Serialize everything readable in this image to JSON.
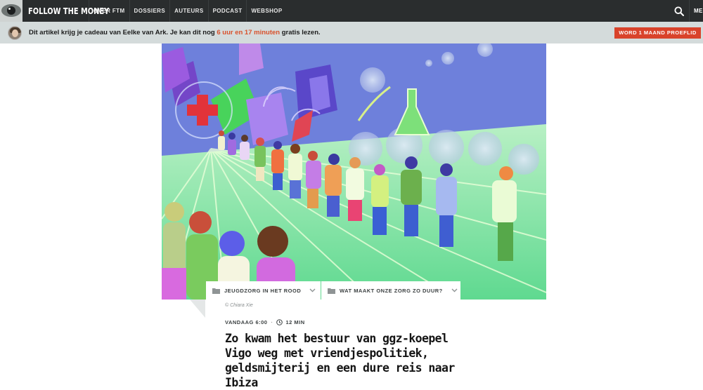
{
  "nav": {
    "logo_text": "FOLLOW THE MONEY",
    "items": [
      {
        "label": "OVER FTM"
      },
      {
        "label": "DOSSIERS"
      },
      {
        "label": "AUTEURS"
      },
      {
        "label": "PODCAST"
      },
      {
        "label": "WEBSHOP"
      }
    ],
    "menu_label": "MENU"
  },
  "gift": {
    "text_before": "Dit artikel krijg je cadeau van Eelke van Ark. Je kan dit nog ",
    "time_left": "6 uur en 17 minuten",
    "text_after": " gratis lezen.",
    "cta_label": "WORD 1 MAAND PROEFLID"
  },
  "tags": [
    {
      "label": "JEUGDZORG IN HET ROOD"
    },
    {
      "label": "WAT MAAKT ONZE ZORG ZO DUUR?"
    }
  ],
  "credit": "© Chiara Xie",
  "meta": {
    "date": "VANDAAG 6:00",
    "reading_time": "12 MIN"
  },
  "headline": "Zo kwam het bestuur van ggz-koepel Vigo weg met vriendjespolitiek, geldsmijterij en een dure reis naar Ibiza",
  "colors": {
    "nav_bg": "#2a2d2e",
    "gift_bg": "#d4dbdb",
    "accent": "#d9432b",
    "highlight": "#d9512c"
  },
  "icons": {
    "search": "search-icon",
    "folder": "folder-icon",
    "chevron": "chevron-down-icon",
    "clock": "clock-icon"
  }
}
